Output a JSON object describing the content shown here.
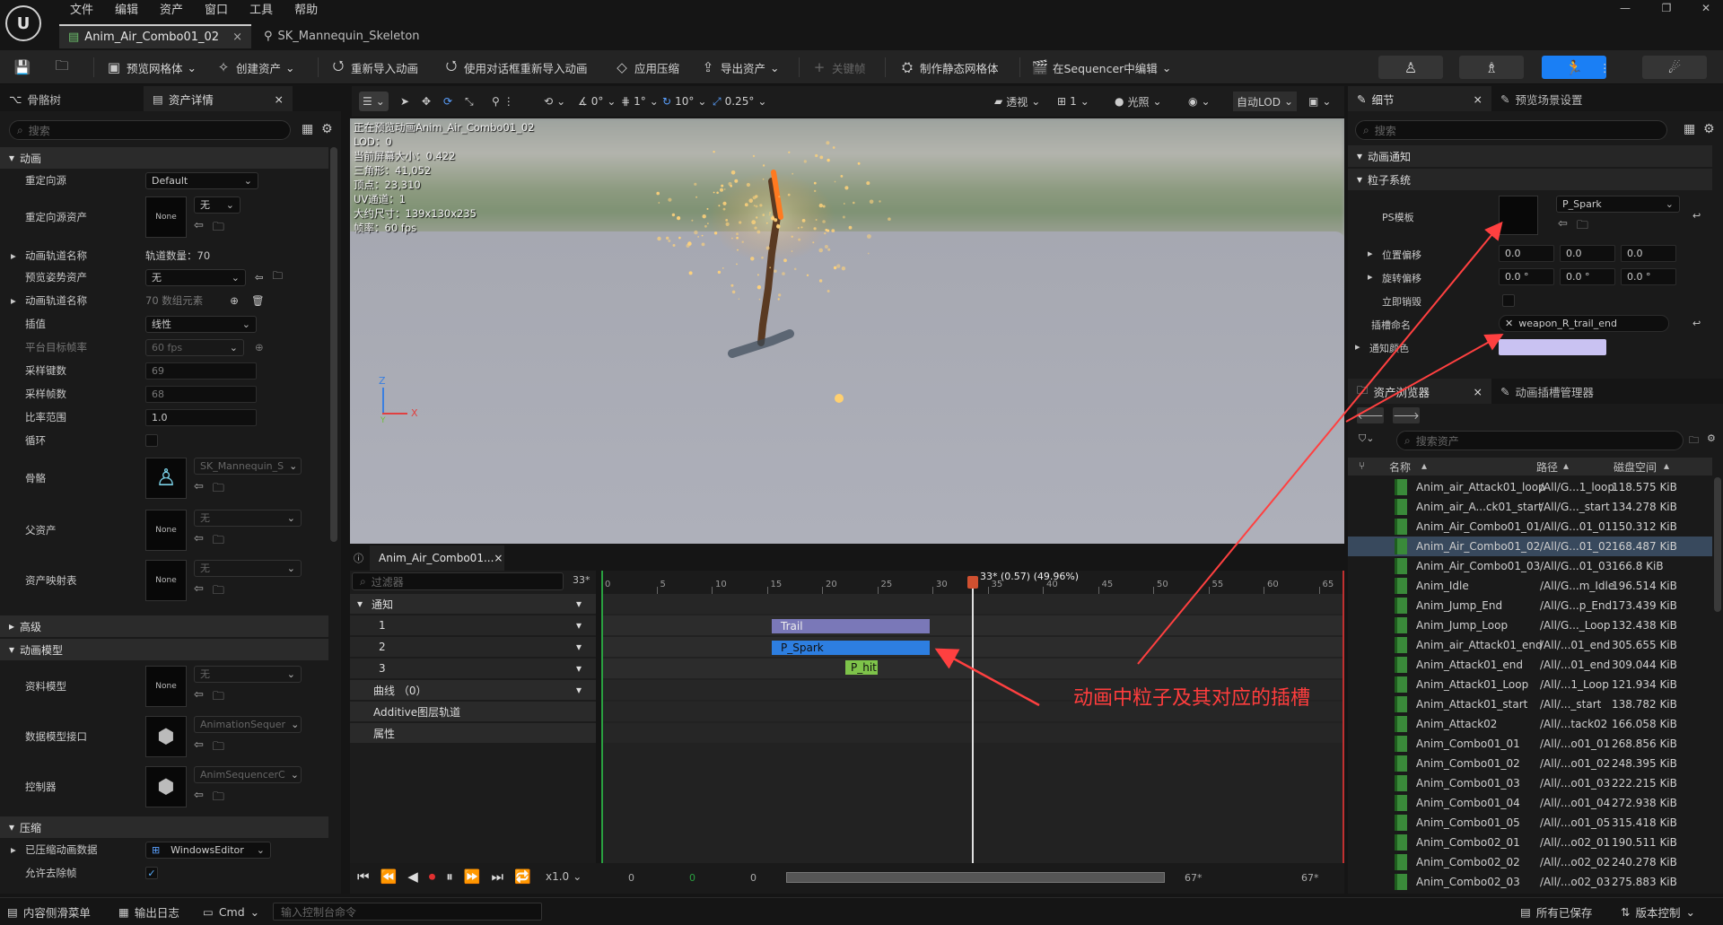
{
  "menu": [
    "文件",
    "编辑",
    "资产",
    "窗口",
    "工具",
    "帮助"
  ],
  "window_controls": [
    "—",
    "❐",
    "✕"
  ],
  "tabs": [
    {
      "label": "Anim_Air_Combo01_02",
      "close": "×"
    },
    {
      "label": "SK_Mannequin_Skeleton"
    }
  ],
  "toolbar": {
    "preview_mesh": "预览网格体",
    "create_asset": "创建资产",
    "reimport": "重新导入动画",
    "reimport_dialog": "使用对话框重新导入动画",
    "apply_compression": "应用压缩",
    "export_asset": "导出资产",
    "keyframe": "关键帧",
    "make_static_mesh": "制作静态网格体",
    "edit_in_sequencer": "在Sequencer中编辑"
  },
  "left_panel": {
    "tabs": [
      "骨骼树",
      "资产详情"
    ],
    "search_placeholder": "搜索",
    "categories": {
      "animation": "动画",
      "advanced": "高级",
      "anim_model": "动画模型",
      "compression": "压缩"
    },
    "props": {
      "retarget_source": {
        "label": "重定向源",
        "value": "Default"
      },
      "retarget_source_asset": {
        "label": "重定向源资产",
        "thumb": "None",
        "value": "无"
      },
      "track_names": {
        "label": "动画轨道名称",
        "value": "轨道数量：70"
      },
      "preview_pose": {
        "label": "预览姿势资产",
        "value": "无"
      },
      "track_names2": {
        "label": "动画轨道名称",
        "value": "70 数组元素"
      },
      "interpolation": {
        "label": "插值",
        "value": "线性"
      },
      "platform_frame_rate": {
        "label": "平台目标帧率",
        "value": "60 fps"
      },
      "sampled_keys": {
        "label": "采样键数",
        "value": "69"
      },
      "sampled_frames": {
        "label": "采样帧数",
        "value": "68"
      },
      "rate_scale": {
        "label": "比率范围",
        "value": "1.0"
      },
      "loop": {
        "label": "循环"
      },
      "skeleton": {
        "label": "骨骼",
        "value": "SK_Mannequin_S"
      },
      "parent_asset": {
        "label": "父资产",
        "thumb": "None",
        "value": "无"
      },
      "asset_mapping": {
        "label": "资产映射表",
        "thumb": "None",
        "value": "无"
      },
      "data_model": {
        "label": "资料模型",
        "thumb": "None",
        "value": "无"
      },
      "data_model_interface": {
        "label": "数据模型接口",
        "value": "AnimationSequer"
      },
      "controller": {
        "label": "控制器",
        "value": "AnimSequencerC"
      },
      "compressed_data": {
        "label": "已压缩动画数据",
        "value": "WindowsEditor"
      },
      "allow_strip": {
        "label": "允许去除帧"
      }
    }
  },
  "viewport": {
    "toolbar": {
      "angle": "0°",
      "grid": "1°",
      "rot": "10°",
      "scale": "0.25°",
      "perspective": "透视",
      "lit": "光照",
      "lod": "自动LOD",
      "speed": "1"
    },
    "stats": [
      "正在预览动画Anim_Air_Combo01_02",
      "LOD：0",
      "当前屏幕大小：0.422",
      "三角形：41,052",
      "顶点：23,310",
      "UV通道：1",
      "大约尺寸：139x130x235",
      "帧率：60 fps"
    ],
    "axis": {
      "z": "Z",
      "x": "X",
      "y": "Y"
    }
  },
  "sequencer": {
    "tab": "Anim_Air_Combo01...",
    "filter_placeholder": "过滤器",
    "frame": "33*",
    "playhead_label": "33* (0.57) (49.96%)",
    "rows": [
      "通知",
      "1",
      "2",
      "3",
      "曲线 （0）",
      "Additive图层轨道",
      "属性"
    ],
    "ticks": [
      "0",
      "5",
      "10",
      "15",
      "20",
      "25",
      "30",
      "35",
      "40",
      "45",
      "50",
      "55",
      "60",
      "65"
    ],
    "notifies": [
      {
        "label": "Trail",
        "color": "#7a78b8"
      },
      {
        "label": "P_Spark",
        "color": "#2d7ee0"
      },
      {
        "label": "P_hit",
        "color": "#7ec34a"
      }
    ],
    "transport": {
      "speed": "x1.0",
      "start": "0",
      "range_start": "0",
      "current": "0",
      "end": "67*",
      "end2": "67*"
    }
  },
  "details": {
    "tabs": [
      "细节",
      "预览场景设置"
    ],
    "search_placeholder": "搜索",
    "cat_notify": "动画通知",
    "cat_particle": "粒子系统",
    "ps_template": {
      "label": "PS模板",
      "value": "P_Spark"
    },
    "location_offset": {
      "label": "位置偏移",
      "values": [
        "0.0",
        "0.0",
        "0.0"
      ]
    },
    "rotation_offset": {
      "label": "旋转偏移",
      "values": [
        "0.0 °",
        "0.0 °",
        "0.0 °"
      ]
    },
    "immediate_destroy": {
      "label": "立即销毁"
    },
    "socket_name": {
      "label": "插槽命名",
      "value": "weapon_R_trail_end"
    },
    "notify_color": {
      "label": "通知颜色",
      "color": "#c9c2f2"
    }
  },
  "asset_browser": {
    "tabs": [
      "资产浏览器",
      "动画插槽管理器"
    ],
    "search_placeholder": "搜索资产",
    "columns": [
      "名称",
      "路径",
      "磁盘空间"
    ],
    "rows": [
      {
        "name": "Anim_air_Attack01_loop",
        "path": "/All/G...1_loop",
        "size": "118.575 KiB"
      },
      {
        "name": "Anim_air_A...ck01_start",
        "path": "/All/G..._start",
        "size": "134.278 KiB"
      },
      {
        "name": "Anim_Air_Combo01_01",
        "path": "/All/G...01_01",
        "size": "150.312 KiB"
      },
      {
        "name": "Anim_Air_Combo01_02",
        "path": "/All/G...01_02",
        "size": "168.487 KiB",
        "selected": true
      },
      {
        "name": "Anim_Air_Combo01_03",
        "path": "/All/G...01_03",
        "size": "166.8 KiB"
      },
      {
        "name": "Anim_Idle",
        "path": "/All/G...m_Idle",
        "size": "196.514 KiB"
      },
      {
        "name": "Anim_Jump_End",
        "path": "/All/G...p_End",
        "size": "173.439 KiB"
      },
      {
        "name": "Anim_Jump_Loop",
        "path": "/All/G..._Loop",
        "size": "132.438 KiB"
      },
      {
        "name": "Anim_air_Attack01_end",
        "path": "/All/...01_end",
        "size": "305.655 KiB"
      },
      {
        "name": "Anim_Attack01_end",
        "path": "/All/...01_end",
        "size": "309.044 KiB"
      },
      {
        "name": "Anim_Attack01_Loop",
        "path": "/All/...1_Loop",
        "size": "121.934 KiB"
      },
      {
        "name": "Anim_Attack01_start",
        "path": "/All/..._start",
        "size": "138.782 KiB"
      },
      {
        "name": "Anim_Attack02",
        "path": "/All/...tack02",
        "size": "166.058 KiB"
      },
      {
        "name": "Anim_Combo01_01",
        "path": "/All/...o01_01",
        "size": "268.856 KiB"
      },
      {
        "name": "Anim_Combo01_02",
        "path": "/All/...o01_02",
        "size": "248.395 KiB"
      },
      {
        "name": "Anim_Combo01_03",
        "path": "/All/...o01_03",
        "size": "222.215 KiB"
      },
      {
        "name": "Anim_Combo01_04",
        "path": "/All/...o01_04",
        "size": "272.938 KiB"
      },
      {
        "name": "Anim_Combo01_05",
        "path": "/All/...o01_05",
        "size": "315.418 KiB"
      },
      {
        "name": "Anim_Combo02_01",
        "path": "/All/...o02_01",
        "size": "190.511 KiB"
      },
      {
        "name": "Anim_Combo02_02",
        "path": "/All/...o02_02",
        "size": "240.278 KiB"
      },
      {
        "name": "Anim_Combo02_03",
        "path": "/All/...o02_03",
        "size": "275.883 KiB"
      }
    ]
  },
  "statusbar": {
    "content_drawer": "内容侧滑菜单",
    "output_log": "输出日志",
    "cmd": "Cmd",
    "console_placeholder": "输入控制台命令",
    "all_saved": "所有已保存",
    "source_control": "版本控制"
  },
  "annotation": "动画中粒子及其对应的插槽"
}
